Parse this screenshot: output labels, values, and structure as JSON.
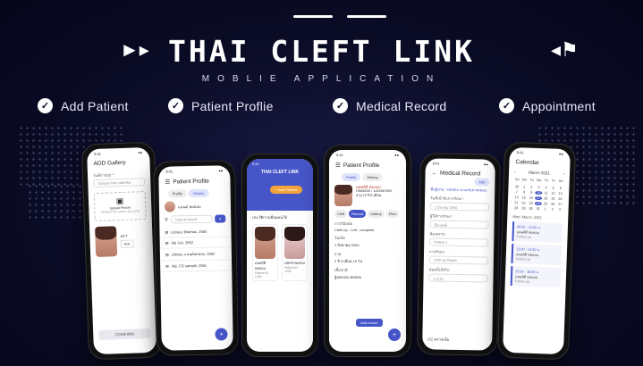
{
  "banner": {
    "title": "THAI CLEFT LINK",
    "subtitle": "MOBLIE APPLICATION",
    "features": [
      "Add Patient",
      "Patient Proflie",
      "Medical Record",
      "Appointment"
    ]
  },
  "phones": {
    "gallery": {
      "time": "9:41",
      "title": "ADD Gallery",
      "field_label": "วันที่ถ่ายรูป *",
      "field_placeholder": "Choose from calendar",
      "upload_label": "Upload Picture",
      "upload_hint": "Allowed file types: jpg, jpeg",
      "photo_tag": "ACT",
      "photo_select": "Ant'",
      "confirm": "CONFIRM"
    },
    "profile": {
      "time": "9:41",
      "title": "Patient Profile",
      "tabs": [
        "Profile",
        "History"
      ],
      "patient_name": "แนนด์ ทดสอบ",
      "search_placeholder": "Date of record",
      "rows": [
        "Library, Bitamau, 2563",
        "Alp Joh, 2562",
        "Library, แนนด์ทดสอบ, 2562",
        "Alp, CG sample, 2561"
      ]
    },
    "home": {
      "time": "9:41",
      "title": "THAI CLEFT LINK",
      "add_button": "Add Patient",
      "section": "ประวัติการเยี่ยมคนไข้",
      "patients": [
        {
          "name": "แพลต์ดี ทดสอบ",
          "detail": "Patient ID: 1234"
        },
        {
          "name": "ฟลักซ์ ทดสอบ",
          "detail": "Patient ID: 1235"
        }
      ]
    },
    "patient_profile": {
      "time": "9:41",
      "title": "Patient Profile",
      "tabs": [
        "Profile",
        "History"
      ],
      "name": "แพลต์ดี ทดสอบ",
      "hn": "HN68205 / 1234567890",
      "age": "อายุ 10 ปี 8 เดือน",
      "chips": [
        "Cleft",
        "Record",
        "Gallery",
        "Plan"
      ],
      "fields": [
        {
          "label": "การวินิจฉัย",
          "value": "Cleft Lip - Left , complete"
        },
        {
          "label": "วันเกิด",
          "value": "1 สิงหาคม 2561"
        },
        {
          "label": "อายุ",
          "value": "2 ปี 3 เดือน 15 วัน"
        },
        {
          "label": "เชื้อชาติ",
          "value": "ผู้ปกครอง ทดสอบ"
        }
      ],
      "record_button": "Add record"
    },
    "medical": {
      "time": "9:41",
      "title": "Medical Record",
      "save": "Add",
      "patient": "ชื่อผู้ป่วย : ทดสอบ นามสกุล ทดสอบ",
      "fields": [
        {
          "label": "วันที่เข้ารับการรักษา",
          "value": "1 มีนาคม 2564"
        },
        {
          "label": "ผู้ให้การรักษา",
          "value": "ชื่อแพทย์"
        },
        {
          "label": "ห้องตรวจ",
          "value": "Patient 1"
        },
        {
          "label": "การรักษา",
          "value": "Cleft Lip Repair"
        },
        {
          "label": "นัดครั้งถัดไป",
          "value": "ระบุวัน"
        }
      ],
      "footer": "CC ตรวจเพิ่ม"
    },
    "calendar": {
      "time": "9:41",
      "title": "Calendar",
      "month": "March 2021",
      "weekdays": [
        "Sun",
        "Mon",
        "Tue",
        "Wed",
        "Thu",
        "Fri",
        "Sat"
      ],
      "days": [
        "28",
        "1",
        "2",
        "3",
        "4",
        "5",
        "6",
        "7",
        "8",
        "9",
        "10",
        "11",
        "12",
        "13",
        "14",
        "15",
        "16",
        "17",
        "18",
        "19",
        "20",
        "21",
        "22",
        "23",
        "24",
        "25",
        "26",
        "27",
        "28",
        "29",
        "30",
        "31",
        "1",
        "2",
        "3"
      ],
      "date_heading": "Wed, March, 2021",
      "appointments": [
        {
          "time": "08:00 - 12:00 น.",
          "name": "แพลต์ดี ทดสอบ",
          "place": "Follow up"
        },
        {
          "time": "13:00 - 14:00 น.",
          "name": "แพลต์ดี ทดสอบ",
          "place": "Follow up"
        },
        {
          "time": "15:00 - 16:00 น.",
          "name": "แพลต์ดี ทดสอบ",
          "place": "Follow up"
        }
      ]
    }
  },
  "colors": {
    "accent": "#4656c9",
    "background": "#0b0c26"
  }
}
